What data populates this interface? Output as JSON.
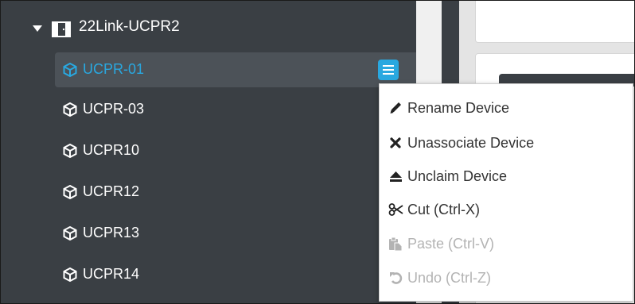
{
  "tree": {
    "parent": {
      "label": "22Link-UCPR2",
      "expanded": true,
      "icon": "door-icon"
    },
    "devices": [
      {
        "label": "UCPR-01",
        "selected": true,
        "icon": "cube-icon"
      },
      {
        "label": "UCPR-03",
        "selected": false,
        "icon": "cube-icon"
      },
      {
        "label": "UCPR10",
        "selected": false,
        "icon": "cube-icon"
      },
      {
        "label": "UCPR12",
        "selected": false,
        "icon": "cube-icon"
      },
      {
        "label": "UCPR13",
        "selected": false,
        "icon": "cube-icon"
      },
      {
        "label": "UCPR14",
        "selected": false,
        "icon": "cube-icon"
      }
    ]
  },
  "context_menu": {
    "items": [
      {
        "label": "Rename Device",
        "icon": "pencil-icon",
        "enabled": true
      },
      {
        "label": "Unassociate Device",
        "icon": "x-mark-icon",
        "enabled": true
      },
      {
        "label": "Unclaim Device",
        "icon": "eject-icon",
        "enabled": true
      },
      {
        "label": "Cut (Ctrl-X)",
        "icon": "scissors-icon",
        "enabled": true
      },
      {
        "label": "Paste (Ctrl-V)",
        "icon": "paste-icon",
        "enabled": false
      },
      {
        "label": "Undo (Ctrl-Z)",
        "icon": "undo-icon",
        "enabled": false
      }
    ]
  },
  "colors": {
    "sidebar_bg": "#3a3f44",
    "selected_bg": "#4c5258",
    "accent": "#29a8e0",
    "disabled_text": "#b3b3b3"
  }
}
